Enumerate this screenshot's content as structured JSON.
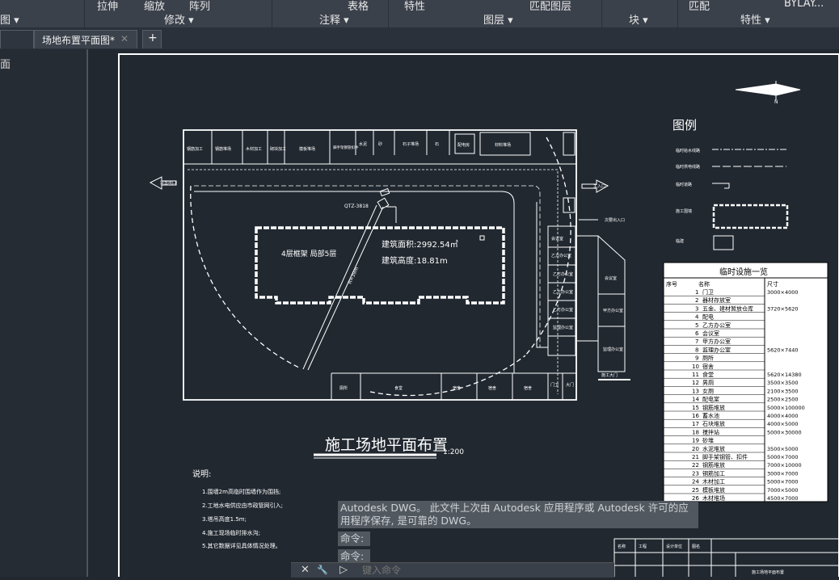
{
  "ribbon": {
    "top_items": [
      "拉伸",
      "缩放",
      "阵列",
      "表格",
      "特性",
      "匹配图层",
      "匹配",
      "BYLAY..."
    ],
    "groups": [
      "图 ▾",
      "修改 ▾",
      "注释 ▾",
      "图层 ▾",
      "块 ▾",
      "特性 ▾"
    ]
  },
  "tabs": {
    "active": "场地布置平面图*",
    "close": "✕",
    "add": "+"
  },
  "sidebar": {
    "label": "面"
  },
  "drawing": {
    "legend_title": "图例",
    "legend_items": [
      "临时给水线路",
      "临时供电线路",
      "临时道路",
      "施工围墙",
      "临建"
    ],
    "north": "N",
    "building_main": "4层框架  局部5层",
    "area": "建筑面积:2992.54㎡",
    "height": "建筑高度:18.81m",
    "crane": "QTZ-3818",
    "crane_radius": "R=39m",
    "title": "施工场地平面布置",
    "scale": "1:200",
    "notes_title": "说明:",
    "notes": [
      "1.围墙2m高临时围墙作为围挡;",
      "2.工地水电供应由市政管网引入;",
      "3.塔吊高度1.5m;",
      "4.施工现场临时排水沟;",
      "5.其它数据详见具体情况处理。"
    ],
    "left_entry": "紧急出口",
    "right_entry": "主入口",
    "secondary_entry": "次要出入口",
    "top_rooms": [
      "钢筋加工",
      "钢筋堆场",
      "木材加工",
      "砌块加工",
      "模板堆场",
      "脚手架钢管扣件",
      "水泥",
      "砂",
      "石子堆场",
      "石",
      "配电房",
      "材料堆场"
    ],
    "right_rooms": [
      "会议室",
      "乙方办公室",
      "乙方办公室",
      "乙方办公室",
      "乙方办公室",
      "甲方办公室",
      "监理办公室"
    ],
    "bottom_rooms": [
      "厕所",
      "食堂",
      "宿舍",
      "宿舍",
      "宿舍",
      "门卫",
      "大门"
    ],
    "gate": "施工大门"
  },
  "facility_table": {
    "title": "临时设施一览",
    "headers": [
      "序号",
      "名称",
      "尺寸"
    ],
    "rows": [
      [
        "1",
        "门卫",
        "3000×4000"
      ],
      [
        "2",
        "器材存放室",
        ""
      ],
      [
        "3",
        "五金、建材暂放仓库",
        "3720×5620"
      ],
      [
        "4",
        "配电",
        ""
      ],
      [
        "5",
        "乙方办公室",
        ""
      ],
      [
        "6",
        "会议室",
        ""
      ],
      [
        "7",
        "甲方办公室",
        ""
      ],
      [
        "8",
        "监理办公室",
        "5620×7440"
      ],
      [
        "9",
        "厕所",
        ""
      ],
      [
        "10",
        "宿舍",
        ""
      ],
      [
        "11",
        "食堂",
        "5620×14380"
      ],
      [
        "12",
        "男厕",
        "3500×3500"
      ],
      [
        "13",
        "女厕",
        "2100×3500"
      ],
      [
        "14",
        "配电室",
        "2500×2500"
      ],
      [
        "15",
        "钢筋堆放",
        "5000×100000"
      ],
      [
        "16",
        "蓄水池",
        "4000×4000"
      ],
      [
        "17",
        "石块堆放",
        "4000×5000"
      ],
      [
        "18",
        "搅拌站",
        "5000×30000"
      ],
      [
        "19",
        "砂堆",
        ""
      ],
      [
        "20",
        "水泥堆放",
        "3500×5000"
      ],
      [
        "21",
        "脚手架钢管、扣件",
        "5000×7000"
      ],
      [
        "22",
        "钢筋堆放",
        "7000×10000"
      ],
      [
        "23",
        "钢筋加工",
        "3000×7000"
      ],
      [
        "24",
        "木材加工",
        "5000×7000"
      ],
      [
        "25",
        "模板堆放",
        "7000×5000"
      ],
      [
        "26",
        "木材堆场",
        "4500×7000"
      ]
    ]
  },
  "command": {
    "history": [
      "Autodesk DWG。  此文件上次由 Autodesk 应用程序或 Autodesk 许可的应用程序保存, 是可靠的 DWG。",
      "命令:",
      "命令:"
    ],
    "placeholder": "键入命令",
    "close_glyph": "✕",
    "wrench_glyph": "🔧",
    "prompt_glyph": "▷"
  },
  "titleblock": {
    "cells": [
      "名称",
      "工程",
      "设计单位",
      "图名",
      "施工场地平面布置"
    ]
  }
}
